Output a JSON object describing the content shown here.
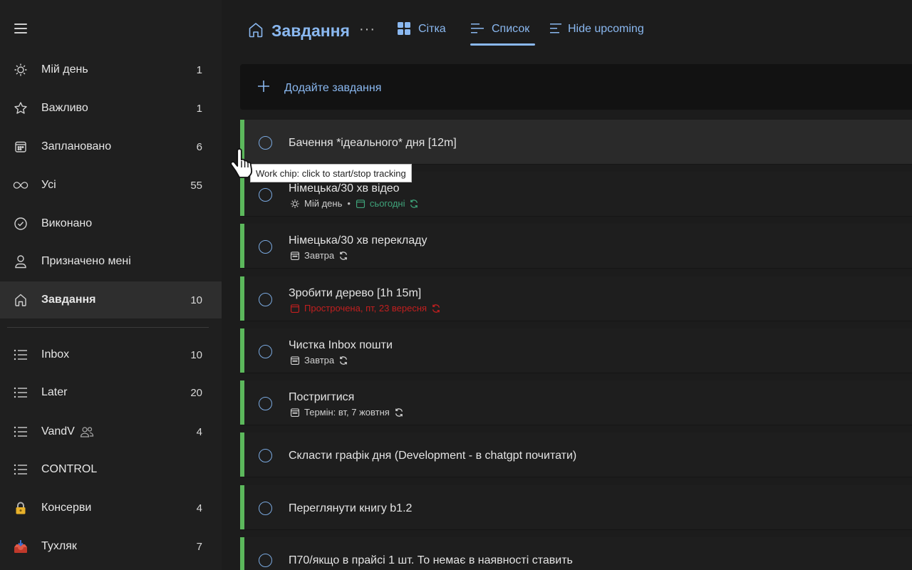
{
  "sidebar": {
    "items": [
      {
        "label": "Мій день",
        "count": "1",
        "icon": "sun-icon"
      },
      {
        "label": "Важливо",
        "count": "1",
        "icon": "star-icon"
      },
      {
        "label": "Заплановано",
        "count": "6",
        "icon": "calendar-icon"
      },
      {
        "label": "Усі",
        "count": "55",
        "icon": "infinity-icon"
      },
      {
        "label": "Виконано",
        "count": "",
        "icon": "check-circle-icon"
      },
      {
        "label": "Призначено мені",
        "count": "",
        "icon": "person-icon"
      },
      {
        "label": "Завдання",
        "count": "10",
        "icon": "home-icon",
        "active": true
      }
    ],
    "lists": [
      {
        "label": "Inbox",
        "count": "10",
        "icon": "list-icon"
      },
      {
        "label": "Later",
        "count": "20",
        "icon": "list-icon"
      },
      {
        "label": "VandV",
        "count": "4",
        "icon": "list-icon",
        "shared": true
      },
      {
        "label": "CONTROL",
        "count": "",
        "icon": "list-icon"
      },
      {
        "label": "Консерви",
        "count": "4",
        "icon": "lock-emoji-icon"
      },
      {
        "label": "Тухляк",
        "count": "7",
        "icon": "inbox-tray-emoji-icon"
      }
    ]
  },
  "header": {
    "title": "Завдання",
    "more": "···",
    "tabs": [
      {
        "label": "Сітка",
        "icon": "grid-icon"
      },
      {
        "label": "Список",
        "icon": "list-view-icon",
        "active": true
      },
      {
        "label": "Hide upcoming",
        "icon": "filter-list-icon"
      }
    ]
  },
  "add_task": {
    "label": "Додайте завдання"
  },
  "tasks": [
    {
      "title": "Бачення *ідеального* дня [12m]"
    },
    {
      "title": "Німецька/30 хв відео",
      "meta": {
        "myday": "Мій день",
        "sep": "•",
        "due": "сьогодні",
        "due_color": "green",
        "repeat": true
      }
    },
    {
      "title": "Німецька/30 хв перекладу",
      "meta": {
        "due": "Завтра",
        "repeat": true
      }
    },
    {
      "title": "Зробити дерево [1h 15m]",
      "meta": {
        "due": "Прострочена, пт, 23 вересня",
        "due_color": "red",
        "repeat": true
      }
    },
    {
      "title": "Чистка Inbox пошти",
      "meta": {
        "due": "Завтра",
        "repeat": true
      }
    },
    {
      "title": "Постригтися",
      "meta": {
        "due": "Термін: вт, 7 жовтня",
        "repeat": true
      }
    },
    {
      "title": "Скласти графік дня (Development - в chatgpt почитати)"
    },
    {
      "title": "Переглянути книгу b1.2"
    },
    {
      "title": "П70/якщо в прайсі 1 шт. То немає в наявності ставить"
    }
  ],
  "tooltip": {
    "text": "Work chip: click to start/stop tracking"
  },
  "colors": {
    "accent": "#8ab8f0",
    "stripe": "#5cb85c",
    "overdue": "#c21f1f",
    "today": "#3fa37a"
  }
}
